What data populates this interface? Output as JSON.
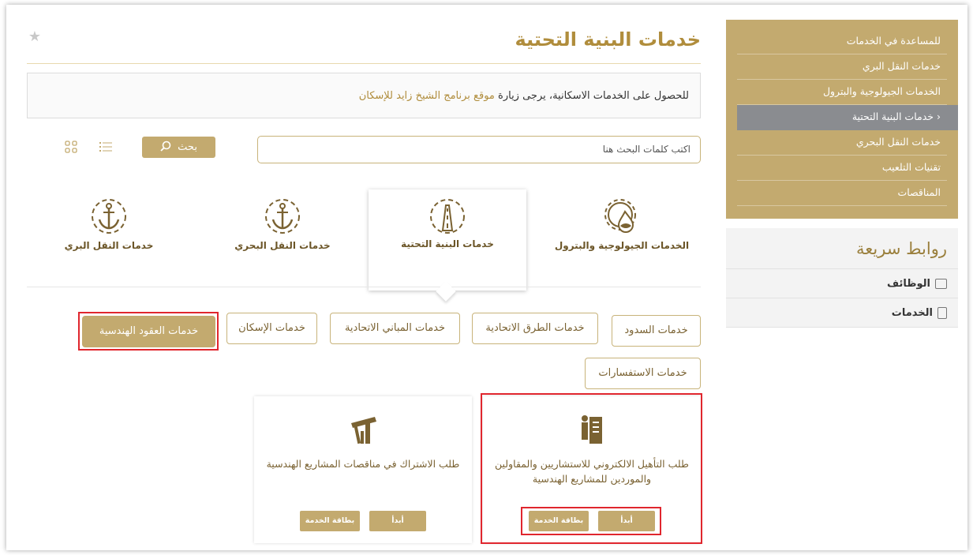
{
  "sidebar": {
    "items": [
      {
        "label": "للمساعدة في الخدمات"
      },
      {
        "label": "خدمات النقل البري"
      },
      {
        "label": "الخدمات الجيولوجية والبترول"
      },
      {
        "label": "خدمات البنية التحتية",
        "active": true
      },
      {
        "label": "خدمات النقل البحري"
      },
      {
        "label": "تقنيات التلعيب"
      },
      {
        "label": "المناقصات"
      }
    ]
  },
  "quick_links": {
    "title": "روابط سريعة",
    "items": [
      {
        "label": "الوظائف",
        "icon": "briefcase-icon"
      },
      {
        "label": "الخدمات",
        "icon": "document-icon"
      }
    ]
  },
  "page": {
    "title": "خدمات البنية التحتية"
  },
  "notice": {
    "text": "للحصول على الخدمات الاسكانية، يرجى زيارة",
    "link": "موقع برنامج الشيخ زايد للإسكان"
  },
  "search": {
    "placeholder": "اكتب كلمات البحث هنا",
    "button_label": "بحث"
  },
  "categories": [
    {
      "label": "الخدمات الجيولوجية والبترول"
    },
    {
      "label": "خدمات البنية التحتية",
      "active": true
    },
    {
      "label": "خدمات النقل البحري"
    },
    {
      "label": "خدمات النقل البري"
    }
  ],
  "tags": [
    {
      "label": "خدمات السدود"
    },
    {
      "label": "خدمات الطرق الاتحادية"
    },
    {
      "label": "خدمات المباني الاتحادية"
    },
    {
      "label": "خدمات الإسكان"
    },
    {
      "label": "خدمات العقود الهندسية",
      "active": true
    },
    {
      "label": "خدمات الاستفسارات"
    }
  ],
  "services": [
    {
      "title": "طلب التأهيل الالكتروني للاستشاريين والمقاولين والموردين للمشاريع الهندسية",
      "start_label": "أبدأ",
      "card_label": "بطاقة الخدمة"
    },
    {
      "title": "طلب الاشتراك في مناقصات المشاريع الهندسية",
      "start_label": "أبدأ",
      "card_label": "بطاقة الخدمة"
    }
  ],
  "colors": {
    "accent": "#c3aa6f",
    "title": "#b08d3c",
    "highlight": "#e0262e"
  }
}
